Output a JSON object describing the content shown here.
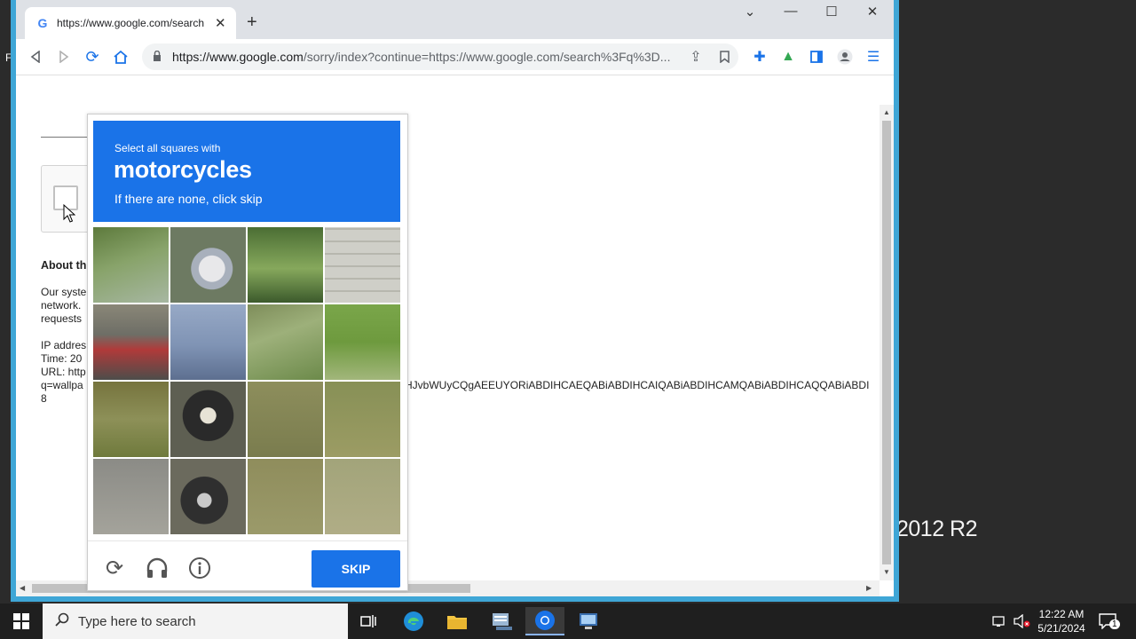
{
  "desktop": {
    "background_text": "2012 R2",
    "edge_glyph": "F"
  },
  "browser": {
    "tab": {
      "title": "https://www.google.com/search",
      "favicon": "G"
    },
    "url": {
      "host": "https://www.google.com",
      "path": "/sorry/index?continue=https://www.google.com/search%3Fq%3D..."
    }
  },
  "page": {
    "about_title": "About th",
    "para1": [
      "Our syste",
      "network.",
      "requests"
    ],
    "para2": [
      "IP addres",
      "Time: 20",
      "URL: http",
      "q=wallpa",
      "8"
    ],
    "long_url_text": "HJvbWUyCQgAEEUYORiABDIHCAEQABiABDIHCAIQABiABDIHCAMQABiABDIHCAQQABiABDI"
  },
  "captcha": {
    "instruction": "Select all squares with",
    "target": "motorcycles",
    "hint": "If there are none, click skip",
    "skip_label": "SKIP",
    "tiles": 16
  },
  "taskbar": {
    "search_placeholder": "Type here to search",
    "time": "12:22 AM",
    "date": "5/21/2024",
    "notification_count": "1"
  },
  "colors": {
    "accent": "#1a73e8",
    "window_border": "#3fa6d6",
    "taskbar": "#1f1f1f"
  }
}
